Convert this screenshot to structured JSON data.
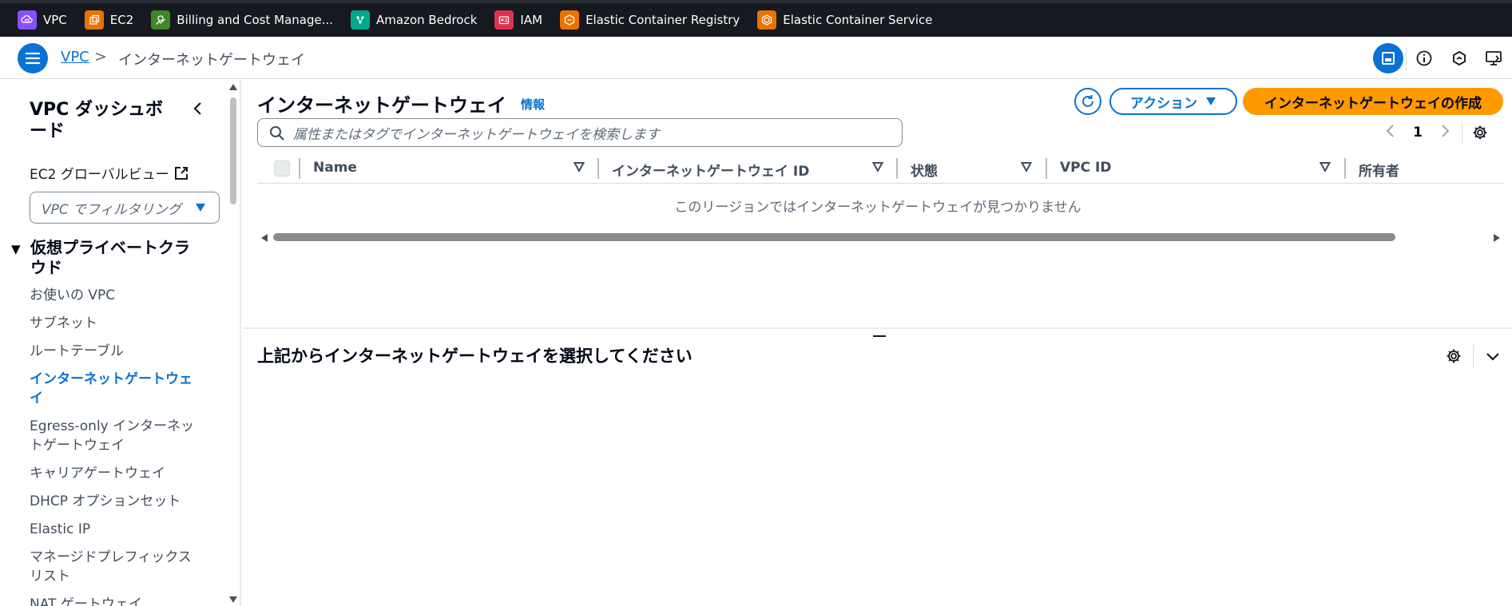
{
  "topbar": {
    "services": [
      {
        "label": "VPC",
        "icon": "vpc-icon",
        "color": "#8c4fff"
      },
      {
        "label": "EC2",
        "icon": "ec2-icon",
        "color": "#ed7100"
      },
      {
        "label": "Billing and Cost Manage...",
        "icon": "billing-icon",
        "color": "#3f8624"
      },
      {
        "label": "Amazon Bedrock",
        "icon": "bedrock-icon",
        "color": "#01a88d"
      },
      {
        "label": "IAM",
        "icon": "iam-icon",
        "color": "#dd344c"
      },
      {
        "label": "Elastic Container Registry",
        "icon": "ecr-icon",
        "color": "#ed7100"
      },
      {
        "label": "Elastic Container Service",
        "icon": "ecs-icon",
        "color": "#ed7100"
      }
    ]
  },
  "breadcrumb": {
    "root": "VPC",
    "separator": ">",
    "current": "インターネットゲートウェイ"
  },
  "sidebar": {
    "title": "VPC ダッシュボード",
    "global_view": "EC2 グローバルビュー",
    "filter_placeholder": "VPC でフィルタリング",
    "section": "仮想プライベートクラウド",
    "items": [
      {
        "label": "お使いの VPC"
      },
      {
        "label": "サブネット"
      },
      {
        "label": "ルートテーブル"
      },
      {
        "label": "インターネットゲートウェイ",
        "active": true
      },
      {
        "label": "Egress-only インターネットゲートウェイ"
      },
      {
        "label": "キャリアゲートウェイ"
      },
      {
        "label": "DHCP オプションセット"
      },
      {
        "label": "Elastic IP"
      },
      {
        "label": "マネージドプレフィックスリスト"
      },
      {
        "label": "NAT ゲートウェイ"
      }
    ]
  },
  "main": {
    "title": "インターネットゲートウェイ",
    "info": "情報",
    "actions_label": "アクション",
    "create_label": "インターネットゲートウェイの作成",
    "search_placeholder": "属性またはタグでインターネットゲートウェイを検索します",
    "page_number": "1",
    "columns": [
      "Name",
      "インターネットゲートウェイ ID",
      "状態",
      "VPC ID",
      "所有者"
    ],
    "empty_message": "このリージョンではインターネットゲートウェイが見つかりません",
    "detail_title": "上記からインターネットゲートウェイを選択してください"
  },
  "colors": {
    "accent": "#0972d3",
    "primary_button": "#ff9900",
    "topbar": "#16191f"
  }
}
